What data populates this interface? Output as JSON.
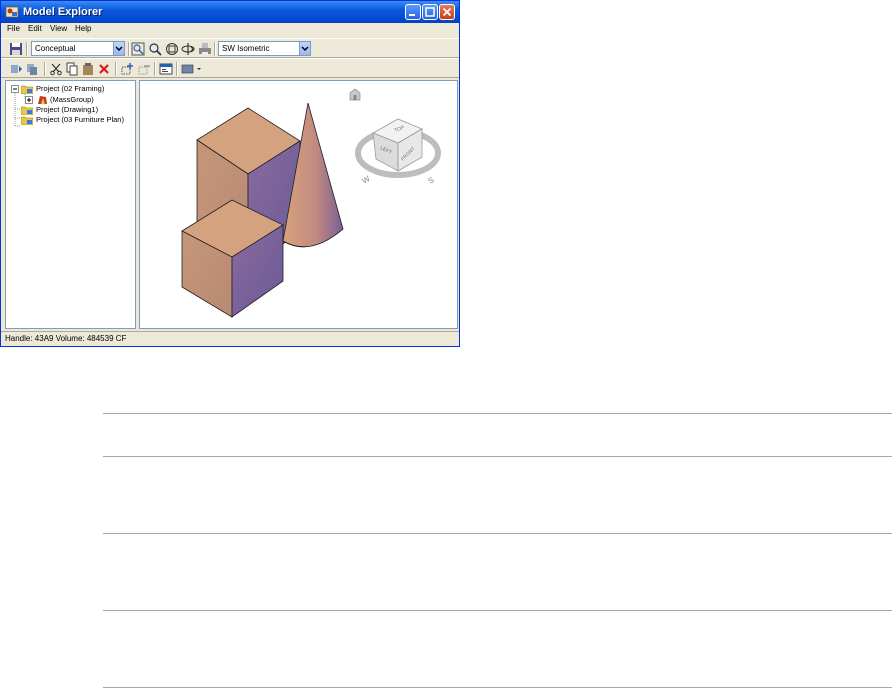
{
  "window": {
    "title": "Model Explorer",
    "app_icon": "model-explorer-icon",
    "controls": [
      "minimize-icon",
      "maximize-icon",
      "close-icon"
    ]
  },
  "menu": [
    "File",
    "Edit",
    "View",
    "Help"
  ],
  "toolbar1": {
    "visual_style": "Conceptual",
    "view_direction": "SW Isometric",
    "icons": [
      "save-icon",
      "zoom-extents-icon",
      "zoom-icon",
      "zoom-window-icon",
      "orbit-icon",
      "print-icon"
    ]
  },
  "toolbar2": {
    "icons": [
      "refresh-icon",
      "refresh-all-icon",
      "cut-icon",
      "copy-icon",
      "paste-icon",
      "delete-icon",
      "add-icon",
      "remove-icon",
      "properties-icon",
      "dropdown-tool-icon"
    ]
  },
  "tree": [
    {
      "label": "Project (02 Framing)",
      "expanded": true
    },
    {
      "label": "(MassGroup)",
      "child": true
    },
    {
      "label": "Project (Drawing1)"
    },
    {
      "label": "Project (03 Furniture Plan)"
    }
  ],
  "viewcube": {
    "faces": [
      "TOP",
      "LEFT",
      "FRONT"
    ],
    "compass": [
      "W",
      "S"
    ]
  },
  "status": "Handle: 43A9  Volume: 484539 CF",
  "colors": {
    "titlebar": "#0a5ae0",
    "mass_top": "#d4a27e",
    "mass_left": "#c28c72",
    "mass_right": "#7a5f95"
  }
}
